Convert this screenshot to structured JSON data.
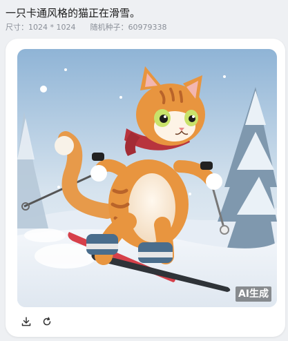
{
  "header": {
    "prompt": "一只卡通风格的猫正在滑雪。",
    "size_label": "尺寸：1024 * 1024",
    "seed_label": "随机种子：60979338"
  },
  "image": {
    "description": "cartoon orange cat skiing on snow",
    "badge": "AI生成"
  },
  "actions": {
    "download": "download-icon",
    "regenerate": "refresh-icon"
  },
  "colors": {
    "page_bg": "#eef0f3",
    "card_bg": "#ffffff"
  }
}
